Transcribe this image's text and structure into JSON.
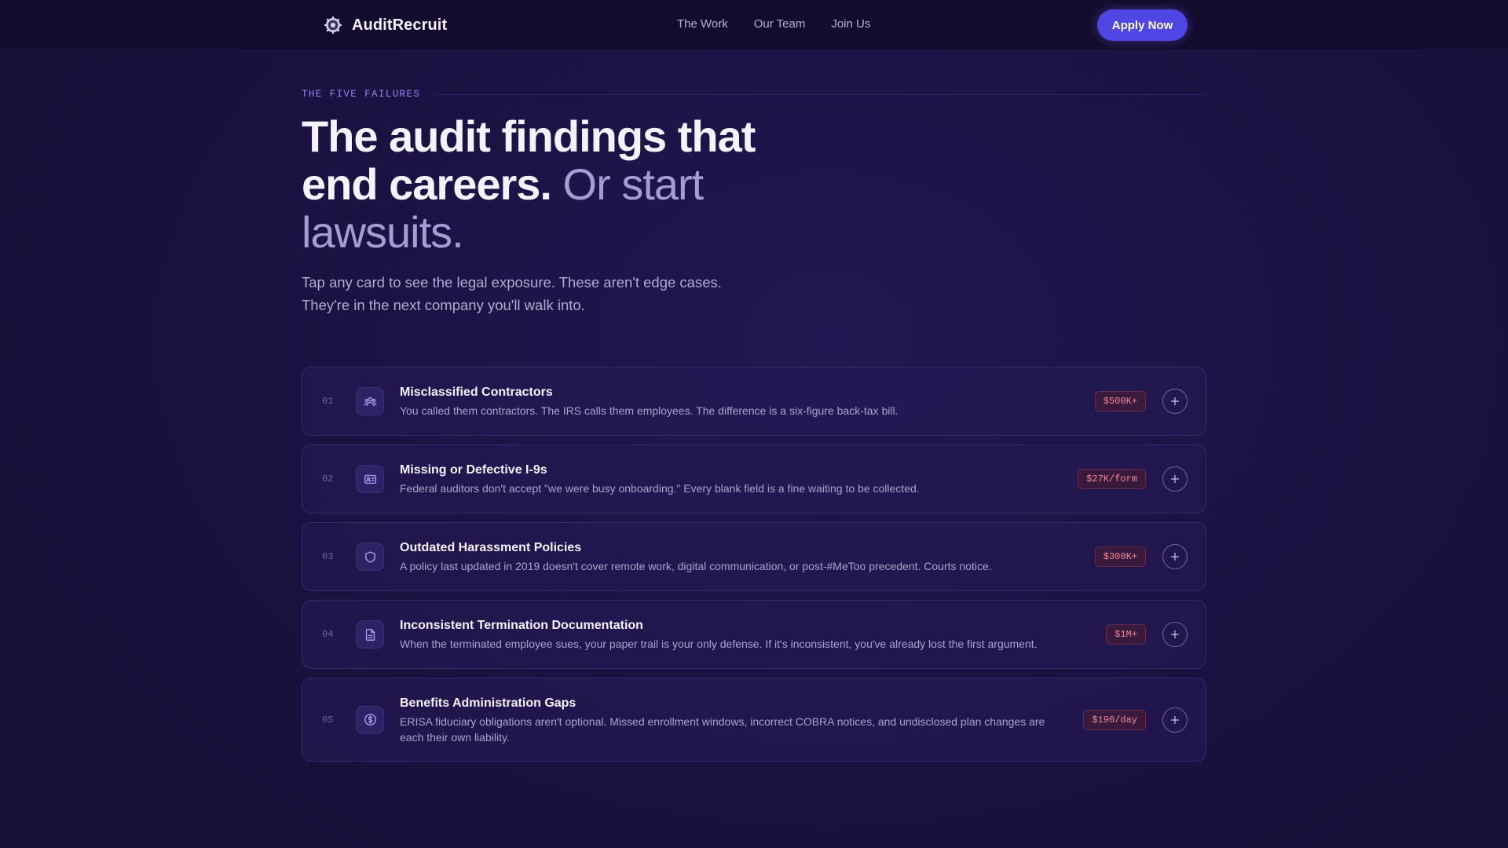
{
  "brand": {
    "name": "AuditRecruit",
    "logo_icon": "seal-logo-icon"
  },
  "nav": {
    "links": [
      "The Work",
      "Our Team",
      "Join Us"
    ],
    "cta": "Apply Now"
  },
  "hero": {
    "eyebrow": "THE FIVE FAILURES",
    "headline_strong": "The audit findings that end careers.",
    "headline_soft": "Or start lawsuits.",
    "lede_line1": "Tap any card to see the legal exposure. These aren't edge cases.",
    "lede_line2": "They're in the next company you'll walk into."
  },
  "cards": [
    {
      "number": "01",
      "icon": "users-icon",
      "title": "Misclassified Contractors",
      "description": "You called them contractors. The IRS calls them employees. The difference is a six-figure back-tax bill.",
      "exposure": "$500K+"
    },
    {
      "number": "02",
      "icon": "id-card-icon",
      "title": "Missing or Defective I-9s",
      "description": "Federal auditors don't accept \"we were busy onboarding.\" Every blank field is a fine waiting to be collected.",
      "exposure": "$27K/form"
    },
    {
      "number": "03",
      "icon": "shield-icon",
      "title": "Outdated Harassment Policies",
      "description": "A policy last updated in 2019 doesn't cover remote work, digital communication, or post-#MeToo precedent. Courts notice.",
      "exposure": "$300K+"
    },
    {
      "number": "04",
      "icon": "document-icon",
      "title": "Inconsistent Termination Documentation",
      "description": "When the terminated employee sues, your paper trail is your only defense. If it's inconsistent, you've already lost the first argument.",
      "exposure": "$1M+"
    },
    {
      "number": "05",
      "icon": "dollar-circle-icon",
      "title": "Benefits Administration Gaps",
      "description": "ERISA fiduciary obligations aren't optional. Missed enrollment windows, incorrect COBRA notices, and undisclosed plan changes are each their own liability.",
      "exposure": "$190/day"
    }
  ],
  "colors": {
    "accent": "#4f46e5",
    "background": "#1a1240",
    "badge_text": "#f08a9a"
  }
}
